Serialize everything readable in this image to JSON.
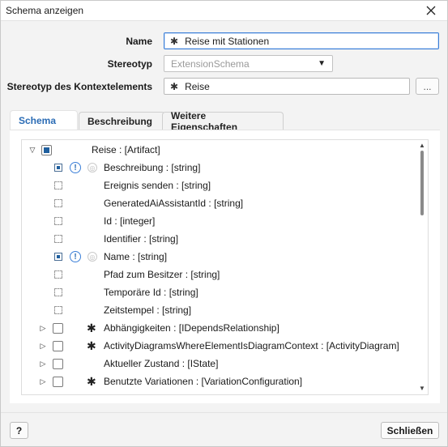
{
  "window": {
    "title": "Schema anzeigen"
  },
  "form": {
    "schema_label": "Name",
    "schema_value": "Reise mit Stationen",
    "stereotype_label": "Stereotyp",
    "stereotype_value": "ExtensionSchema",
    "context_label": "Stereotyp des Kontextelements",
    "context_value": "Reise",
    "browse_label": "..."
  },
  "tabs": [
    {
      "label": "Schema"
    },
    {
      "label": "Beschreibung"
    },
    {
      "label": "Weitere Eigenschaften"
    }
  ],
  "tree": {
    "root": {
      "label": "Reise : [Artifact]"
    },
    "attributes": [
      {
        "label": "Beschreibung : [string]",
        "selected": true,
        "info": true
      },
      {
        "label": "Ereignis senden : [string]",
        "selected": false,
        "info": false
      },
      {
        "label": "GeneratedAiAssistantId : [string]",
        "selected": false,
        "info": false
      },
      {
        "label": "Id : [integer]",
        "selected": false,
        "info": false
      },
      {
        "label": "Identifier : [string]",
        "selected": false,
        "info": false
      },
      {
        "label": "Name : [string]",
        "selected": true,
        "info": true
      },
      {
        "label": "Pfad zum Besitzer : [string]",
        "selected": false,
        "info": false
      },
      {
        "label": "Temporäre Id : [string]",
        "selected": false,
        "info": false
      },
      {
        "label": "Zeitstempel : [string]",
        "selected": false,
        "info": false
      }
    ],
    "associations": [
      {
        "label": "Abhängigkeiten : [IDependsRelationship]",
        "many": true
      },
      {
        "label": "ActivityDiagramsWhereElementIsDiagramContext : [ActivityDiagram]",
        "many": true
      },
      {
        "label": "Aktueller Zustand : [IState]",
        "many": false
      },
      {
        "label": "Benutzte Variationen : [VariationConfiguration]",
        "many": true
      }
    ]
  },
  "buttons": {
    "help": "?",
    "close": "Schließen"
  },
  "icons": {
    "close": "close-icon",
    "dropdown": "chevron-down-icon",
    "info": "info-icon",
    "multiplicity": "asterisk-icon"
  },
  "colors": {
    "accent": "#2b6cb5",
    "check_fill": "#1f5f9e",
    "focus_border": "#3b7fd8"
  }
}
